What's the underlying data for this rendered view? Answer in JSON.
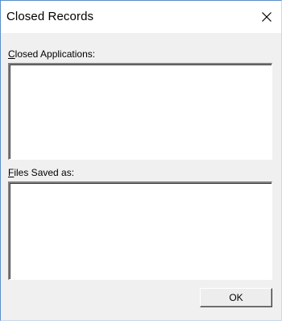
{
  "window": {
    "title": "Closed Records",
    "close_symbol": "×"
  },
  "closed_applications": {
    "label_accel": "C",
    "label_rest": "losed Applications:",
    "items": []
  },
  "files_saved": {
    "label_accel": "F",
    "label_rest": "iles Saved as:",
    "items": []
  },
  "buttons": {
    "ok_label": "OK"
  },
  "icons": {
    "close": "close-icon"
  }
}
